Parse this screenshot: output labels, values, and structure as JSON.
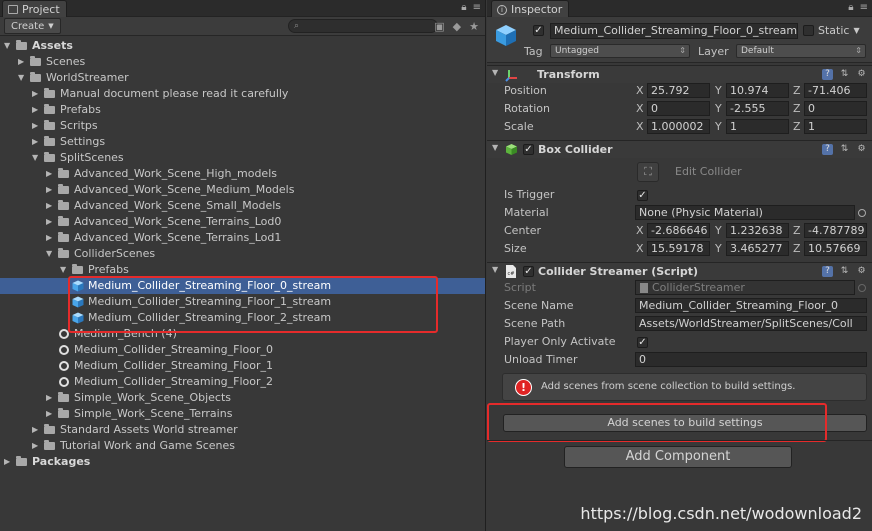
{
  "project": {
    "tab_title": "Project",
    "create_label": "Create",
    "tree": [
      {
        "label": "Assets",
        "depth": 0,
        "type": "folder",
        "expanded": true,
        "bold": true
      },
      {
        "label": "Scenes",
        "depth": 1,
        "type": "folder",
        "expanded": false
      },
      {
        "label": "WorldStreamer",
        "depth": 1,
        "type": "folder",
        "expanded": true
      },
      {
        "label": "Manual document please read it carefully",
        "depth": 2,
        "type": "folder",
        "expanded": false
      },
      {
        "label": "Prefabs",
        "depth": 2,
        "type": "folder",
        "expanded": false
      },
      {
        "label": "Scritps",
        "depth": 2,
        "type": "folder",
        "expanded": false
      },
      {
        "label": "Settings",
        "depth": 2,
        "type": "folder",
        "expanded": false
      },
      {
        "label": "SplitScenes",
        "depth": 2,
        "type": "folder",
        "expanded": true
      },
      {
        "label": "Advanced_Work_Scene_High_models",
        "depth": 3,
        "type": "folder",
        "expanded": false
      },
      {
        "label": "Advanced_Work_Scene_Medium_Models",
        "depth": 3,
        "type": "folder",
        "expanded": false
      },
      {
        "label": "Advanced_Work_Scene_Small_Models",
        "depth": 3,
        "type": "folder",
        "expanded": false
      },
      {
        "label": "Advanced_Work_Scene_Terrains_Lod0",
        "depth": 3,
        "type": "folder",
        "expanded": false
      },
      {
        "label": "Advanced_Work_Scene_Terrains_Lod1",
        "depth": 3,
        "type": "folder",
        "expanded": false
      },
      {
        "label": "ColliderScenes",
        "depth": 3,
        "type": "folder",
        "expanded": true
      },
      {
        "label": "Prefabs",
        "depth": 4,
        "type": "folder",
        "expanded": true
      },
      {
        "label": "Medium_Collider_Streaming_Floor_0_stream",
        "depth": 5,
        "type": "prefab",
        "selected": true
      },
      {
        "label": "Medium_Collider_Streaming_Floor_1_stream",
        "depth": 5,
        "type": "prefab"
      },
      {
        "label": "Medium_Collider_Streaming_Floor_2_stream",
        "depth": 5,
        "type": "prefab"
      },
      {
        "label": "Medium_Bench (4)",
        "depth": 4,
        "type": "scene"
      },
      {
        "label": "Medium_Collider_Streaming_Floor_0",
        "depth": 4,
        "type": "scene"
      },
      {
        "label": "Medium_Collider_Streaming_Floor_1",
        "depth": 4,
        "type": "scene"
      },
      {
        "label": "Medium_Collider_Streaming_Floor_2",
        "depth": 4,
        "type": "scene"
      },
      {
        "label": "Simple_Work_Scene_Objects",
        "depth": 3,
        "type": "folder",
        "expanded": false
      },
      {
        "label": "Simple_Work_Scene_Terrains",
        "depth": 3,
        "type": "folder",
        "expanded": false
      },
      {
        "label": "Standard Assets World streamer",
        "depth": 2,
        "type": "folder",
        "expanded": false
      },
      {
        "label": "Tutorial Work and Game Scenes",
        "depth": 2,
        "type": "folder",
        "expanded": false
      },
      {
        "label": "Packages",
        "depth": 0,
        "type": "folder",
        "expanded": false,
        "bold": true
      }
    ]
  },
  "inspector": {
    "tab_title": "Inspector",
    "object_name": "Medium_Collider_Streaming_Floor_0_stream",
    "static_label": "Static",
    "tag_label": "Tag",
    "tag_value": "Untagged",
    "layer_label": "Layer",
    "layer_value": "Default",
    "transform": {
      "title": "Transform",
      "position_label": "Position",
      "rotation_label": "Rotation",
      "scale_label": "Scale",
      "position": {
        "x": "25.792",
        "y": "10.974",
        "z": "-71.406"
      },
      "rotation": {
        "x": "0",
        "y": "-2.555",
        "z": "0"
      },
      "scale": {
        "x": "1.000002",
        "y": "1",
        "z": "1"
      }
    },
    "box_collider": {
      "title": "Box Collider",
      "edit_collider_label": "Edit Collider",
      "is_trigger_label": "Is Trigger",
      "material_label": "Material",
      "material_value": "None (Physic Material)",
      "center_label": "Center",
      "size_label": "Size",
      "center": {
        "x": "-2.686646",
        "y": "1.232638",
        "z": "-4.787789"
      },
      "size": {
        "x": "15.59178",
        "y": "3.465277",
        "z": "10.57669"
      }
    },
    "collider_streamer": {
      "title": "Collider Streamer (Script)",
      "script_label": "Script",
      "script_value": "ColliderStreamer",
      "scene_name_label": "Scene Name",
      "scene_name_value": "Medium_Collider_Streaming_Floor_0",
      "scene_path_label": "Scene Path",
      "scene_path_value": "Assets/WorldStreamer/SplitScenes/Coll",
      "player_only_label": "Player Only Activate",
      "unload_timer_label": "Unload Timer",
      "unload_timer_value": "0",
      "help_text": "Add scenes from scene collection to build settings.",
      "add_scenes_button": "Add scenes to build settings"
    },
    "add_component_label": "Add Component"
  },
  "axis": {
    "x": "X",
    "y": "Y",
    "z": "Z"
  },
  "watermark": "https://blog.csdn.net/wodownload2",
  "colors": {
    "selection": "#3e5f96",
    "highlight_box": "#e52b2b",
    "panel_bg": "#383838"
  }
}
